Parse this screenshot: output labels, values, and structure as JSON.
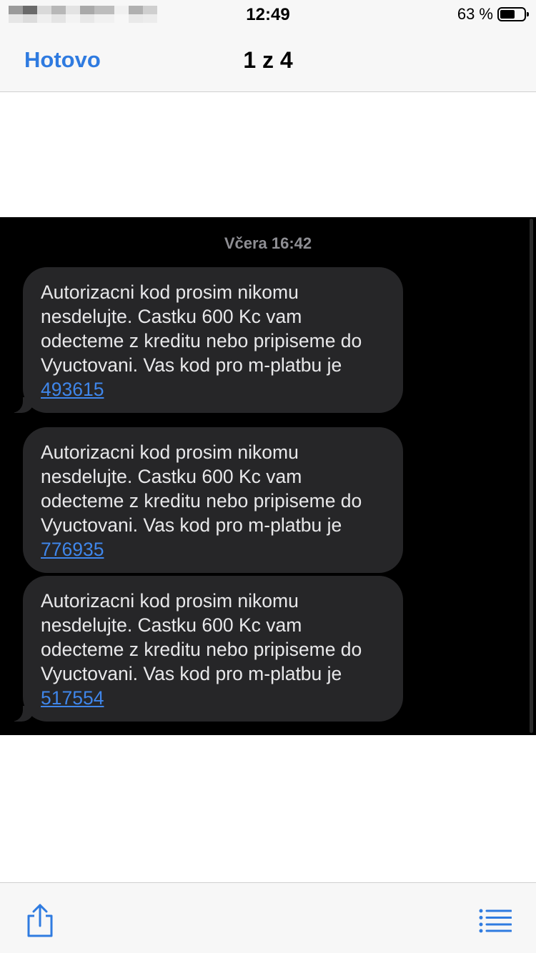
{
  "status_bar": {
    "time": "12:49",
    "battery_percent": "63 %",
    "battery_level": 0.63
  },
  "navbar": {
    "done_label": "Hotovo",
    "title": "1 z 4"
  },
  "message_thread": {
    "timestamp": "Včera 16:42",
    "messages": [
      {
        "text": "Autorizacni kod prosim nikomu nesdelujte. Castku 600 Kc vam odecteme z kreditu nebo pripiseme do Vyuctovani. Vas kod pro m-platbu je",
        "code": "493615"
      },
      {
        "text": "Autorizacni kod prosim nikomu nesdelujte. Castku 600 Kc vam odecteme z kreditu nebo pripiseme do Vyuctovani. Vas kod pro m-platbu je",
        "code": "776935"
      },
      {
        "text": "Autorizacni kod prosim nikomu nesdelujte. Castku 600 Kc vam odecteme z kreditu nebo pripiseme do Vyuctovani. Vas kod pro m-platbu je",
        "code": "517554"
      }
    ]
  },
  "toolbar": {
    "share_icon": "share-icon",
    "list_icon": "list-icon"
  },
  "colors": {
    "accent": "#2f7be0",
    "bubble": "#262628",
    "link": "#3f86ea"
  }
}
